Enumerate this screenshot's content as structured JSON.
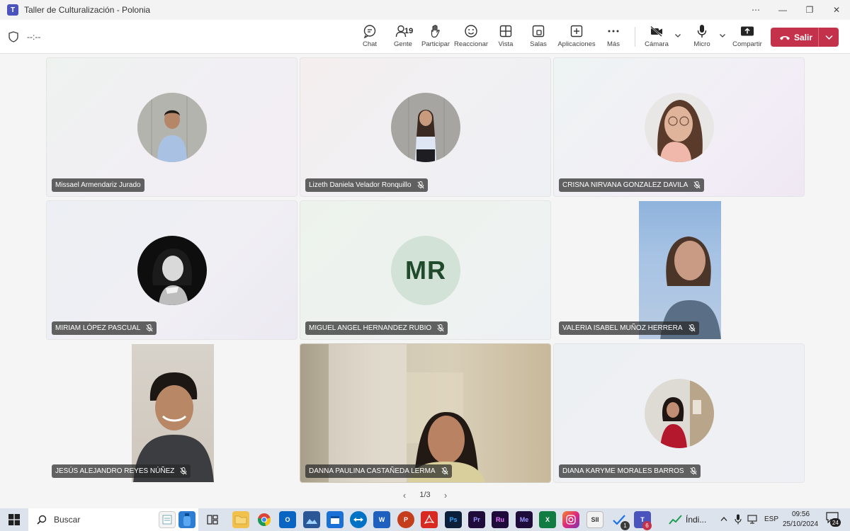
{
  "window": {
    "title": "Taller de Culturalización - Polonia",
    "controls": [
      "⋯",
      "—",
      "❐",
      "✕"
    ]
  },
  "meeting": {
    "timer": "--:--",
    "toolbar": {
      "chat": "Chat",
      "people": "Gente",
      "people_count": "19",
      "raise": "Participar",
      "react": "Reaccionar",
      "view": "Vista",
      "rooms": "Salas",
      "apps": "Aplicaciones",
      "more": "Más",
      "camera": "Cámara",
      "mic": "Micro",
      "share": "Compartir",
      "leave": "Salir"
    }
  },
  "participants": [
    {
      "name": "Missael Armendariz Jurado",
      "muted": false
    },
    {
      "name": "Lizeth Daniela Velador Ronquillo",
      "muted": true
    },
    {
      "name": "CRISNA NIRVANA GONZALEZ DAVILA",
      "muted": true
    },
    {
      "name": "MIRIAM LÓPEZ PASCUAL",
      "muted": true
    },
    {
      "name": "MIGUEL ANGEL HERNANDEZ RUBIO",
      "muted": true,
      "initials": "MR"
    },
    {
      "name": "VALERIA ISABEL MUÑOZ HERRERA",
      "muted": true
    },
    {
      "name": "JESÚS ALEJANDRO REYES NÚÑEZ",
      "muted": true
    },
    {
      "name": "DANNA PAULINA CASTAÑEDA LERMA",
      "muted": true
    },
    {
      "name": "DIANA KARYME MORALES BARROS",
      "muted": true
    }
  ],
  "pagination": {
    "label": "1/3"
  },
  "taskbar": {
    "search_label": "Buscar",
    "apps": [
      "Ps",
      "Pr",
      "Ru",
      "Me"
    ],
    "notification_badge": "1",
    "teams_badge": "6",
    "stock_label": "Índi...",
    "language": "ESP",
    "time": "09:56",
    "date": "25/10/2024",
    "notifications": "24"
  },
  "colors": {
    "leave": "#c4314b",
    "taskbar": "#dde3ec",
    "initials_bg": "#d2e2d6"
  }
}
